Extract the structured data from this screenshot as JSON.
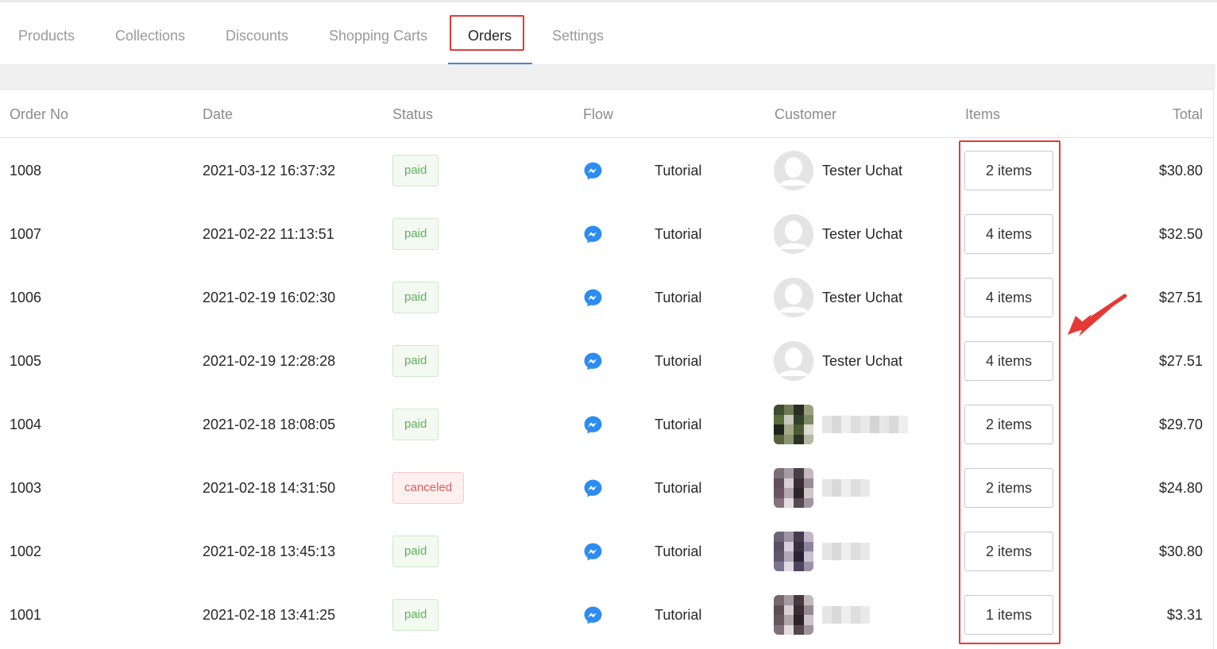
{
  "tabs": [
    {
      "label": "Products",
      "active": false
    },
    {
      "label": "Collections",
      "active": false
    },
    {
      "label": "Discounts",
      "active": false
    },
    {
      "label": "Shopping Carts",
      "active": false
    },
    {
      "label": "Orders",
      "active": true
    },
    {
      "label": "Settings",
      "active": false
    }
  ],
  "table": {
    "columns": [
      "Order No",
      "Date",
      "Status",
      "Flow",
      "Customer",
      "Items",
      "Total"
    ],
    "rows": [
      {
        "order_no": "1008",
        "date": "2021-03-12 16:37:32",
        "status": "paid",
        "flow": "Tutorial",
        "customer": "Tester Uchat",
        "items": "2 items",
        "total": "$30.80"
      },
      {
        "order_no": "1007",
        "date": "2021-02-22 11:13:51",
        "status": "paid",
        "flow": "Tutorial",
        "customer": "Tester Uchat",
        "items": "4 items",
        "total": "$32.50"
      },
      {
        "order_no": "1006",
        "date": "2021-02-19 16:02:30",
        "status": "paid",
        "flow": "Tutorial",
        "customer": "Tester Uchat",
        "items": "4 items",
        "total": "$27.51"
      },
      {
        "order_no": "1005",
        "date": "2021-02-19 12:28:28",
        "status": "paid",
        "flow": "Tutorial",
        "customer": "Tester Uchat",
        "items": "4 items",
        "total": "$27.51"
      },
      {
        "order_no": "1004",
        "date": "2021-02-18 18:08:05",
        "status": "paid",
        "flow": "Tutorial",
        "customer": "",
        "items": "2 items",
        "total": "$29.70"
      },
      {
        "order_no": "1003",
        "date": "2021-02-18 14:31:50",
        "status": "canceled",
        "flow": "Tutorial",
        "customer": "",
        "items": "2 items",
        "total": "$24.80"
      },
      {
        "order_no": "1002",
        "date": "2021-02-18 13:45:13",
        "status": "paid",
        "flow": "Tutorial",
        "customer": "",
        "items": "2 items",
        "total": "$30.80"
      },
      {
        "order_no": "1001",
        "date": "2021-02-18 13:41:25",
        "status": "paid",
        "flow": "Tutorial",
        "customer": "",
        "items": "1 items",
        "total": "$3.31"
      }
    ]
  },
  "icons": {
    "flow": "messenger-icon",
    "avatar_default": "user-avatar-placeholder-icon",
    "annotation": "red-arrow-icon"
  },
  "colors": {
    "accent": "#4a86d8",
    "highlight": "#e53935",
    "paid_text": "#5db35a",
    "canceled_text": "#e05a5a",
    "messenger": "#2d8cf0"
  }
}
